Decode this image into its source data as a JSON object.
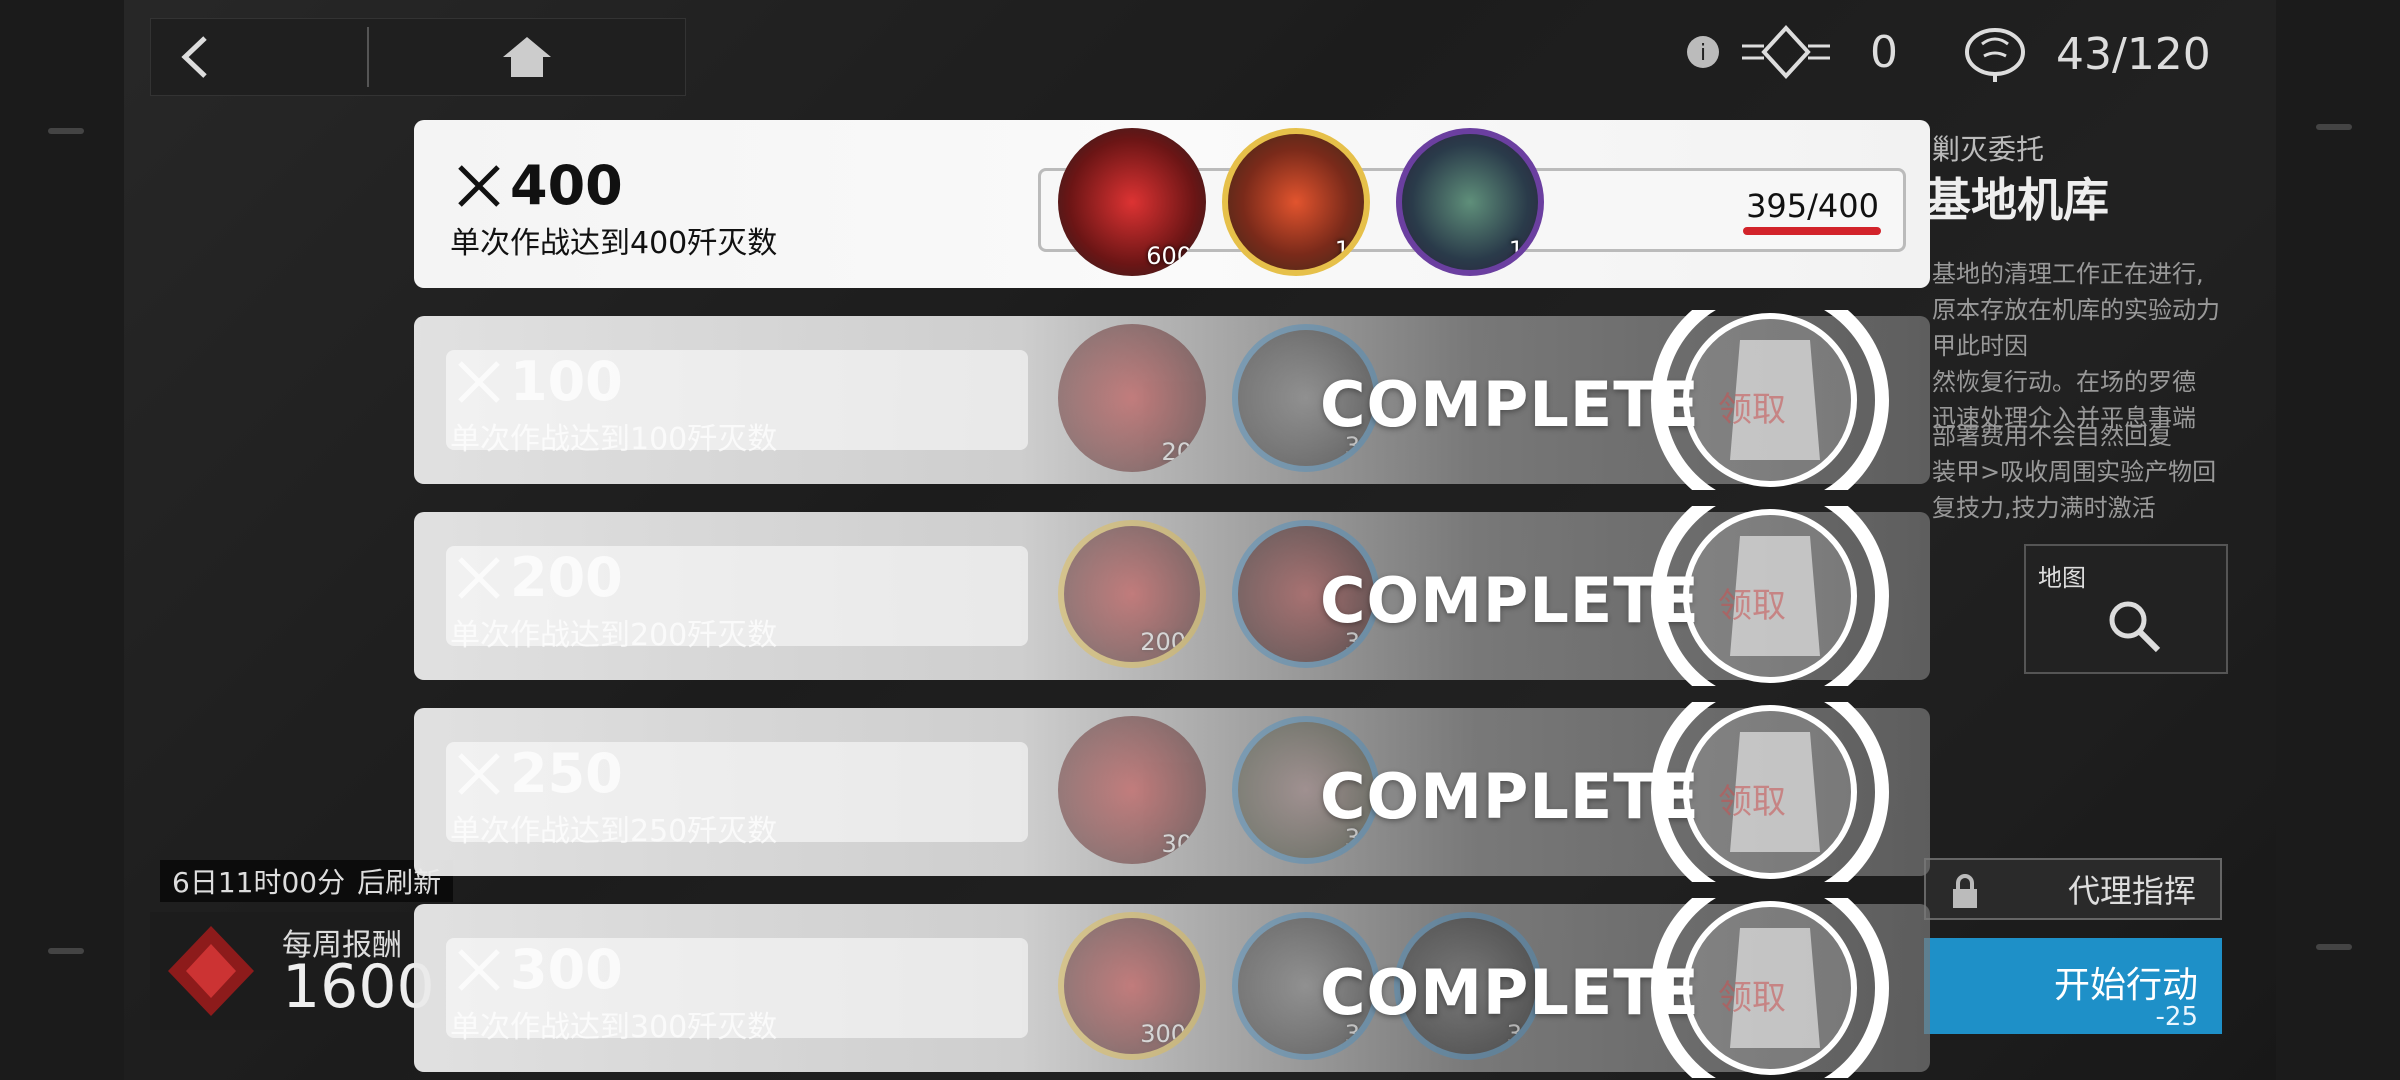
{
  "topbar": {
    "back_icon": "chevron-left-icon",
    "home_icon": "home-icon"
  },
  "resources": {
    "medal_count": "0",
    "sanity": "43/120"
  },
  "right_panel": {
    "subtitle": "剿灭委托",
    "title": "基地机库",
    "desc_lines": [
      "基地的清理工作正在进行,",
      "原本存放在机库的实验动力甲此时因",
      "然恢复行动。在场的罗德",
      "迅速处理介入并平息事端"
    ],
    "deploy_lines": [
      "部署费用不会自然回复",
      "装甲>吸收周围实验产物回",
      "复技力,技力满时激活"
    ],
    "map_label": "地图",
    "proxy_label": "代理指挥",
    "start_label": "开始行动",
    "start_cost": "-25"
  },
  "bottom_left": {
    "refresh_time": "6日11时00分",
    "refresh_suffix": "后刷新",
    "weekly_label": "每周报酬",
    "weekly_value": "1600"
  },
  "tasks": [
    {
      "count": "400",
      "desc": "单次作战达到400歼灭数",
      "progress": "395/400",
      "state": "active",
      "rewards": [
        {
          "icon": "orundum-icon",
          "qty": "600"
        },
        {
          "icon": "chip-crate-icon",
          "qty": "1"
        },
        {
          "icon": "battery-module-icon",
          "qty": "1"
        }
      ]
    },
    {
      "count": "100",
      "desc": "单次作战达到100歼灭数",
      "state": "complete",
      "complete_label": "COMPLETE",
      "claim_label": "领取",
      "rewards": [
        {
          "icon": "ammo-box-icon",
          "qty": "20"
        },
        {
          "icon": "device-icon",
          "qty": "3"
        }
      ]
    },
    {
      "count": "200",
      "desc": "单次作战达到200歼灭数",
      "state": "complete",
      "complete_label": "COMPLETE",
      "claim_label": "领取",
      "rewards": [
        {
          "icon": "orundum-icon",
          "qty": "200"
        },
        {
          "icon": "ammo-box-icon",
          "qty": "3"
        }
      ]
    },
    {
      "count": "250",
      "desc": "单次作战达到250歼灭数",
      "state": "complete",
      "complete_label": "COMPLETE",
      "claim_label": "领取",
      "rewards": [
        {
          "icon": "ammo-box-icon",
          "qty": "30"
        },
        {
          "icon": "ore-icon",
          "qty": "3"
        }
      ]
    },
    {
      "count": "300",
      "desc": "单次作战达到300歼灭数",
      "state": "complete",
      "complete_label": "COMPLETE",
      "claim_label": "领取",
      "rewards": [
        {
          "icon": "orundum-icon",
          "qty": "300"
        },
        {
          "icon": "device-icon",
          "qty": "3"
        },
        {
          "icon": "chip-icon",
          "qty": "3"
        }
      ]
    }
  ]
}
